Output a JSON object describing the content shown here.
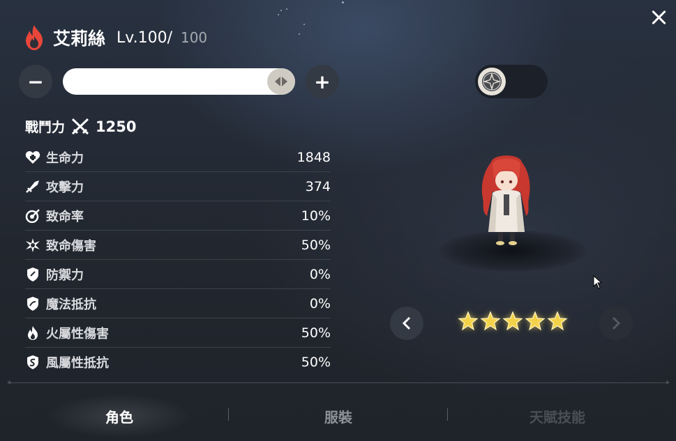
{
  "header": {
    "element_icon": "fire-element-icon",
    "character_name": "艾莉絲",
    "level": "Lv.100/",
    "max_level": "100"
  },
  "level_controls": {
    "decrease_label": "−",
    "increase_label": "+",
    "slider_fraction": 1.0
  },
  "combat_power": {
    "label": "戰鬥力",
    "value": "1250"
  },
  "stats": [
    {
      "icon": "heart-plus-icon",
      "name": "生命力",
      "value": "1848"
    },
    {
      "icon": "sword-icon",
      "name": "攻擊力",
      "value": "374"
    },
    {
      "icon": "crit-rate-icon",
      "name": "致命率",
      "value": "10%"
    },
    {
      "icon": "crit-damage-icon",
      "name": "致命傷害",
      "value": "50%"
    },
    {
      "icon": "shield-icon",
      "name": "防禦力",
      "value": "0%"
    },
    {
      "icon": "magic-shield-icon",
      "name": "魔法抵抗",
      "value": "0%"
    },
    {
      "icon": "fire-icon",
      "name": "火屬性傷害",
      "value": "50%"
    },
    {
      "icon": "wind-shield-icon",
      "name": "風屬性抵抗",
      "value": "50%"
    }
  ],
  "rating": {
    "stars": 5,
    "max": 5
  },
  "tabs": [
    {
      "label": "角色",
      "state": "active"
    },
    {
      "label": "服裝",
      "state": "normal"
    },
    {
      "label": "天賦技能",
      "state": "locked"
    }
  ],
  "colors": {
    "fire_accent": "#e8463a",
    "star_gold": "#f3d24a",
    "panel_dark": "#343a44"
  }
}
